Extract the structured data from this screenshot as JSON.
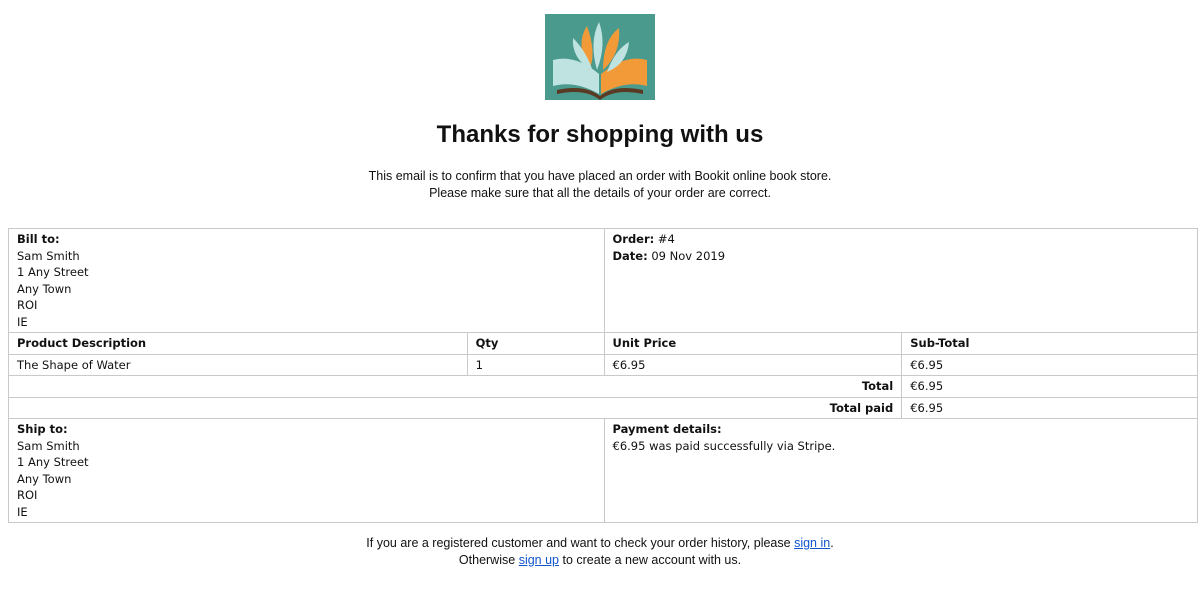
{
  "logo": {
    "icon": "book-lotus-logo",
    "bg_color": "#4a9a8e",
    "accent_left": "#bfe3e0",
    "accent_right": "#f39a38"
  },
  "heading": "Thanks for shopping with us",
  "intro": {
    "line1": "This email is to confirm that you have placed an order with Bookit online book store.",
    "line2": "Please make sure that all the details of your order are correct."
  },
  "bill_to": {
    "label": "Bill to:",
    "lines": [
      "Sam Smith",
      "1 Any Street",
      "Any Town",
      "ROI",
      "IE"
    ]
  },
  "order": {
    "order_label": "Order:",
    "order_number": "#4",
    "date_label": "Date:",
    "date_value": "09 Nov 2019"
  },
  "items_table": {
    "headers": [
      "Product Description",
      "Qty",
      "Unit Price",
      "Sub-Total"
    ],
    "rows": [
      [
        "The Shape of Water",
        "1",
        "€6.95",
        "€6.95"
      ]
    ],
    "total_label": "Total",
    "total_value": "€6.95",
    "total_paid_label": "Total paid",
    "total_paid_value": "€6.95"
  },
  "ship_to": {
    "label": "Ship to:",
    "lines": [
      "Sam Smith",
      "1 Any Street",
      "Any Town",
      "ROI",
      "IE"
    ]
  },
  "payment": {
    "label": "Payment details:",
    "text": "€6.95 was paid successfully via Stripe."
  },
  "footer": {
    "line1_prefix": "If you are a registered customer and want to check your order history, please",
    "sign_in": "sign in",
    "line1_suffix": ".",
    "line2_prefix": "Otherwise",
    "sign_up": "sign up",
    "line2_suffix": "to create a new account with us."
  }
}
